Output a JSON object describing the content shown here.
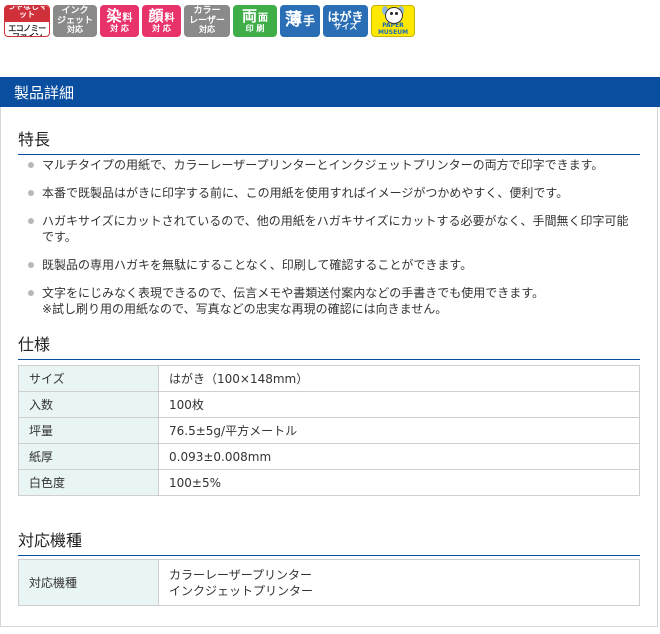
{
  "badges": [
    {
      "id": "eco",
      "top": "つやなしマット",
      "bottom": "エコノミーファイン"
    },
    {
      "id": "ink",
      "line1": "インク",
      "line2": "ジェット",
      "line3": "対応"
    },
    {
      "id": "dye",
      "big": "染",
      "small1": "料",
      "small2": "対 応"
    },
    {
      "id": "pig",
      "big": "顔",
      "small1": "料",
      "small2": "対 応"
    },
    {
      "id": "laser",
      "line1": "カラー",
      "line2": "レーザー",
      "line3": "対応"
    },
    {
      "id": "duplex",
      "big": "両",
      "small1": "面",
      "small2": "印 刷"
    },
    {
      "id": "thin",
      "big": "薄",
      "small1": "手"
    },
    {
      "id": "hagaki",
      "line1": "はがき",
      "line2": "サイズ"
    },
    {
      "id": "museum",
      "label": "PAPER MUSEUM"
    }
  ],
  "header": {
    "title": "製品詳細"
  },
  "features": {
    "title": "特長",
    "items": [
      "マルチタイプの用紙で、カラーレーザープリンターとインクジェットプリンターの両方で印字できます。",
      "本番で既製品はがきに印字する前に、この用紙を使用すればイメージがつかめやすく、便利です。",
      "ハガキサイズにカットされているので、他の用紙をハガキサイズにカットする必要がなく、手間無く印字可能です。",
      "既製品の専用ハガキを無駄にすることなく、印刷して確認することができます。"
    ],
    "last_item_line1": "文字をにじみなく表現できるので、伝言メモや書類送付案内などの手書きでも使用できます。",
    "last_item_line2": "※試し刷り用の用紙なので、写真などの忠実な再現の確認には向きません。"
  },
  "spec": {
    "title": "仕様",
    "rows": [
      {
        "key": "サイズ",
        "value": "はがき（100×148mm）"
      },
      {
        "key": "入数",
        "value": "100枚"
      },
      {
        "key": "坪量",
        "value": "76.5±5g/平方メートル"
      },
      {
        "key": "紙厚",
        "value": "0.093±0.008mm"
      },
      {
        "key": "白色度",
        "value": "100±5%"
      }
    ]
  },
  "compat": {
    "title": "対応機種",
    "key": "対応機種",
    "value_line1": "カラーレーザープリンター",
    "value_line2": "インクジェットプリンター"
  }
}
